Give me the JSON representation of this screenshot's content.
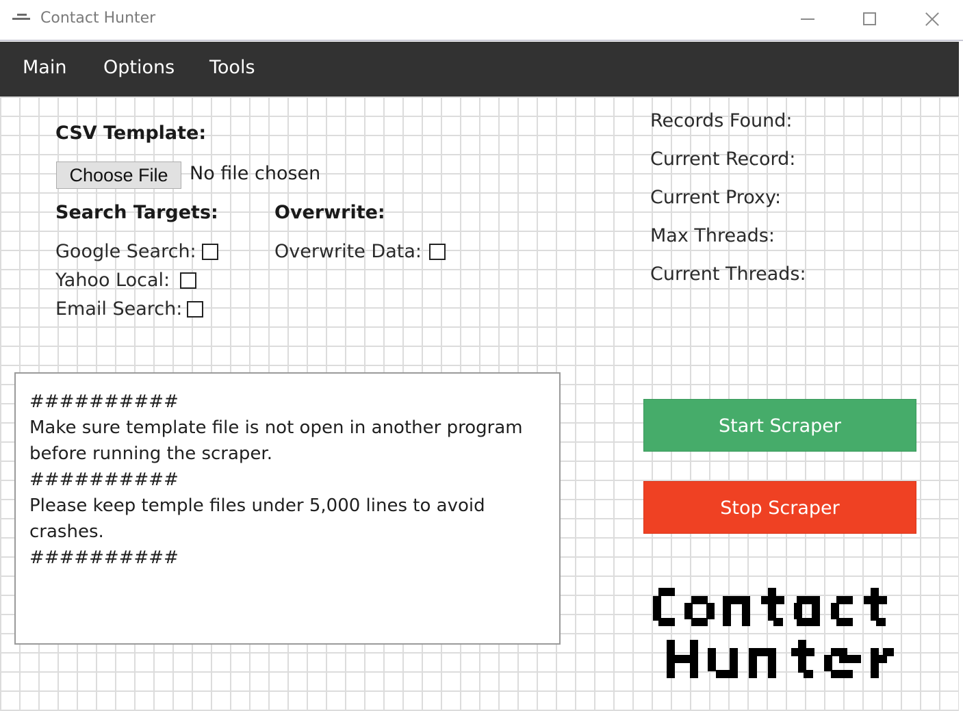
{
  "window": {
    "title": "Contact Hunter",
    "icon": "app-icon",
    "controls": {
      "minimize": "minimize-icon",
      "maximize": "maximize-icon",
      "close": "close-icon"
    }
  },
  "menu": {
    "items": [
      {
        "label": "Main"
      },
      {
        "label": "Options"
      },
      {
        "label": "Tools"
      }
    ]
  },
  "csv": {
    "heading": "CSV Template:",
    "choose_button": "Choose File",
    "file_status": "No file chosen"
  },
  "search_targets": {
    "heading": "Search Targets:",
    "options": [
      {
        "label": "Google Search:",
        "checked": false
      },
      {
        "label": "Yahoo Local:",
        "checked": false
      },
      {
        "label": "Email Search:",
        "checked": false
      }
    ]
  },
  "overwrite": {
    "heading": "Overwrite:",
    "options": [
      {
        "label": "Overwrite Data:",
        "checked": false
      }
    ]
  },
  "notes": {
    "lines": [
      "##########",
      "Make sure template file is not open in another program",
      "before running the scraper.",
      "##########",
      "Please keep temple files under 5,000 lines to avoid",
      "crashes.",
      "##########"
    ]
  },
  "stats": {
    "records_found": "Records Found:",
    "current_record": "Current Record:",
    "current_proxy": "Current Proxy:",
    "max_threads": "Max Threads:",
    "current_threads": "Current Threads:"
  },
  "actions": {
    "start_label": "Start Scraper",
    "stop_label": "Stop Scraper",
    "start_color": "#46ac6a",
    "stop_color": "#ef4123"
  },
  "logo": {
    "line1": "Contact",
    "line2": "Hunter"
  }
}
